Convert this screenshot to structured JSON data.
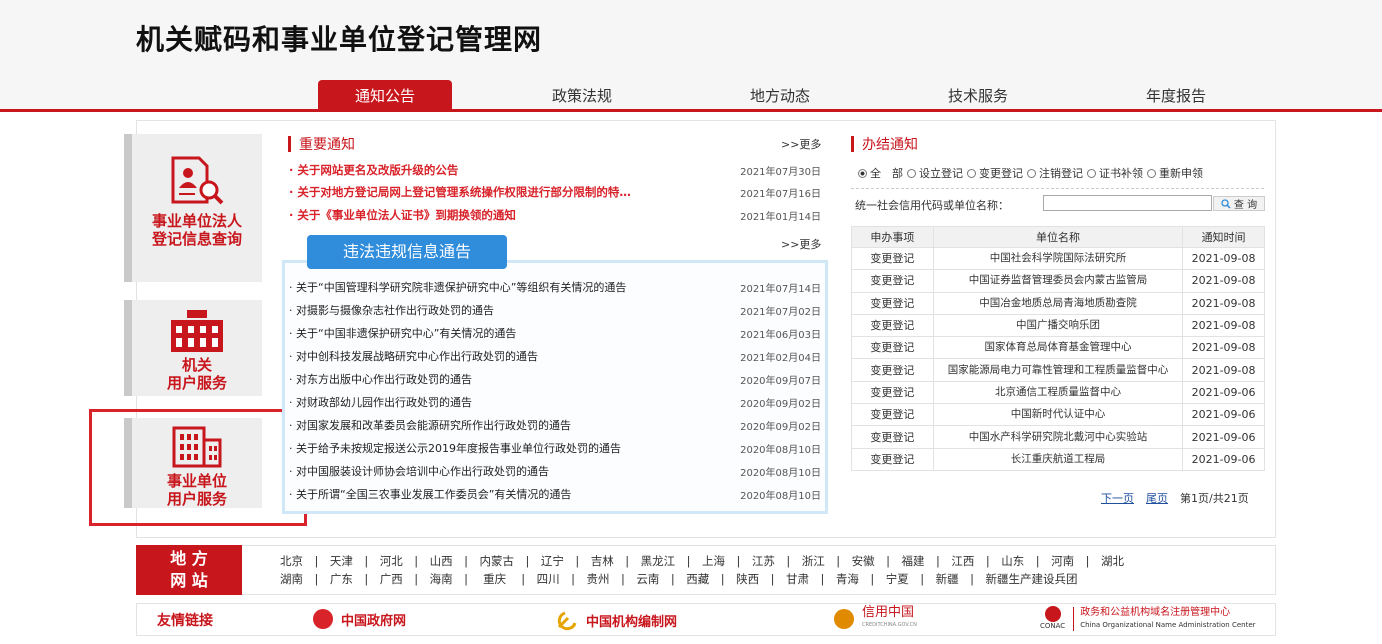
{
  "site": {
    "title": "机关赋码和事业单位登记管理网"
  },
  "nav": [
    {
      "label": "通知公告",
      "active": true
    },
    {
      "label": "政策法规",
      "active": false
    },
    {
      "label": "地方动态",
      "active": false
    },
    {
      "label": "技术服务",
      "active": false
    },
    {
      "label": "年度报告",
      "active": false
    }
  ],
  "sidebar": {
    "legal_query": {
      "line1": "事业单位法人",
      "line2": "登记信息查询"
    },
    "gov_service": {
      "line1": "机关",
      "line2": "用户服务"
    },
    "inst_service": {
      "line1": "事业单位",
      "line2": "用户服务"
    }
  },
  "important": {
    "title": "重要通知",
    "more": ">>更多",
    "items": [
      {
        "title": "· 关于网站更名及改版升级的公告",
        "date": "2021年07月30日"
      },
      {
        "title": "· 关于对地方登记局网上登记管理系统操作权限进行部分限制的特…",
        "date": "2021年07月16日"
      },
      {
        "title": "· 关于《事业单位法人证书》到期换领的通知",
        "date": "2021年01月14日"
      }
    ]
  },
  "violations": {
    "title": "违法违规信息通告",
    "more": ">>更多",
    "items": [
      {
        "title": "· 关于“中国管理科学研究院非遗保护研究中心”等组织有关情况的通告",
        "date": "2021年07月14日"
      },
      {
        "title": "· 对摄影与摄像杂志社作出行政处罚的通告",
        "date": "2021年07月02日"
      },
      {
        "title": "· 关于“中国非遗保护研究中心”有关情况的通告",
        "date": "2021年06月03日"
      },
      {
        "title": "· 对中创科技发展战略研究中心作出行政处罚的通告",
        "date": "2021年02月04日"
      },
      {
        "title": "· 对东方出版中心作出行政处罚的通告",
        "date": "2020年09月07日"
      },
      {
        "title": "· 对财政部幼儿园作出行政处罚的通告",
        "date": "2020年09月02日"
      },
      {
        "title": "· 对国家发展和改革委员会能源研究所作出行政处罚的通告",
        "date": "2020年09月02日"
      },
      {
        "title": "· 关于给予未按规定报送公示2019年度报告事业单位行政处罚的通告",
        "date": "2020年08月10日"
      },
      {
        "title": "· 对中国服装设计师协会培训中心作出行政处罚的通告",
        "date": "2020年08月10日"
      },
      {
        "title": "· 关于所谓“全国三农事业发展工作委员会”有关情况的通告",
        "date": "2020年08月10日"
      }
    ]
  },
  "results": {
    "title": "办结通知",
    "filters": [
      "全　部",
      "设立登记",
      "变更登记",
      "注销登记",
      "证书补领",
      "重新申领"
    ],
    "search_label": "统一社会信用代码或单位名称：",
    "search_value": "",
    "search_button": "查 询",
    "columns": [
      "申办事项",
      "单位名称",
      "通知时间"
    ],
    "rows": [
      [
        "变更登记",
        "中国社会科学院国际法研究所",
        "2021-09-08"
      ],
      [
        "变更登记",
        "中国证券监督管理委员会内蒙古监管局",
        "2021-09-08"
      ],
      [
        "变更登记",
        "中国冶金地质总局青海地质勘查院",
        "2021-09-08"
      ],
      [
        "变更登记",
        "中国广播交响乐团",
        "2021-09-08"
      ],
      [
        "变更登记",
        "国家体育总局体育基金管理中心",
        "2021-09-08"
      ],
      [
        "变更登记",
        "国家能源局电力可靠性管理和工程质量监督中心",
        "2021-09-08"
      ],
      [
        "变更登记",
        "北京通信工程质量监督中心",
        "2021-09-06"
      ],
      [
        "变更登记",
        "中国新时代认证中心",
        "2021-09-06"
      ],
      [
        "变更登记",
        "中国水产科学研究院北戴河中心实验站",
        "2021-09-06"
      ],
      [
        "变更登记",
        "长江重庆航道工程局",
        "2021-09-06"
      ]
    ],
    "pager": {
      "next": "下一页",
      "last": "尾页",
      "info": "第1页/共21页"
    }
  },
  "regions": {
    "label1": "地 方",
    "label2": "网 站",
    "line1": "北京　|　天津　|　河北　|　山西　|　内蒙古　|　辽宁　|　吉林　|　黑龙江　|　上海　|　江苏　|　浙江　|　安徽　|　福建　|　江西　|　山东　|　河南　|　湖北",
    "line2": "湖南　|　广东　|　广西　|　海南　|　 重庆　 |　四川　|　贵州　|　云南　|　西藏　|　陕西　|　甘肃　|　青海　|　宁夏　|　新疆　|　新疆生产建设兵团"
  },
  "links": {
    "label": "友情链接",
    "items": [
      "中国政府网",
      "中国机构编制网",
      "信用中国",
      "政务和公益机构域名注册管理中心"
    ],
    "credit_sub": "CREDITCHINA.GOV.CN",
    "conac_sub": "China Organizational Name Administration Center",
    "conac_abbr": "CONAC"
  },
  "colors": {
    "brand_red": "#c8161d",
    "violation_blue": "#2f8ddc",
    "link_blue": "#1f4f9e"
  }
}
